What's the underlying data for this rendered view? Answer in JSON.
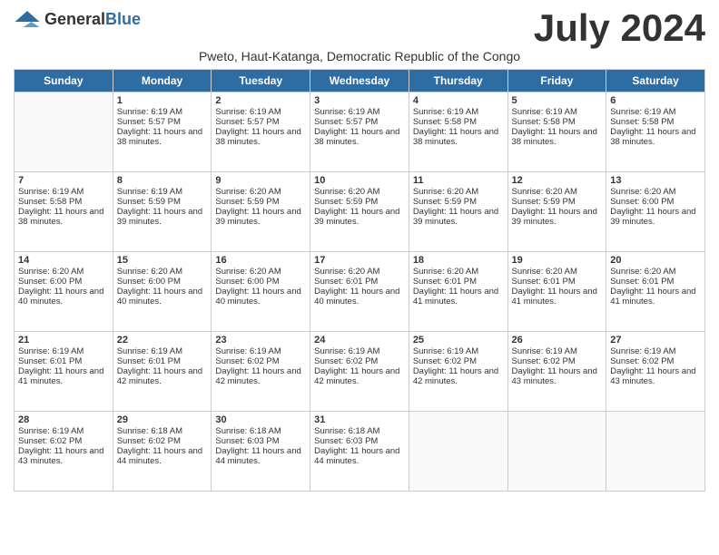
{
  "header": {
    "logo_general": "General",
    "logo_blue": "Blue",
    "month_title": "July 2024",
    "subtitle": "Pweto, Haut-Katanga, Democratic Republic of the Congo"
  },
  "days_of_week": [
    "Sunday",
    "Monday",
    "Tuesday",
    "Wednesday",
    "Thursday",
    "Friday",
    "Saturday"
  ],
  "weeks": [
    [
      {
        "day": "",
        "sunrise": "",
        "sunset": "",
        "daylight": ""
      },
      {
        "day": "1",
        "sunrise": "Sunrise: 6:19 AM",
        "sunset": "Sunset: 5:57 PM",
        "daylight": "Daylight: 11 hours and 38 minutes."
      },
      {
        "day": "2",
        "sunrise": "Sunrise: 6:19 AM",
        "sunset": "Sunset: 5:57 PM",
        "daylight": "Daylight: 11 hours and 38 minutes."
      },
      {
        "day": "3",
        "sunrise": "Sunrise: 6:19 AM",
        "sunset": "Sunset: 5:57 PM",
        "daylight": "Daylight: 11 hours and 38 minutes."
      },
      {
        "day": "4",
        "sunrise": "Sunrise: 6:19 AM",
        "sunset": "Sunset: 5:58 PM",
        "daylight": "Daylight: 11 hours and 38 minutes."
      },
      {
        "day": "5",
        "sunrise": "Sunrise: 6:19 AM",
        "sunset": "Sunset: 5:58 PM",
        "daylight": "Daylight: 11 hours and 38 minutes."
      },
      {
        "day": "6",
        "sunrise": "Sunrise: 6:19 AM",
        "sunset": "Sunset: 5:58 PM",
        "daylight": "Daylight: 11 hours and 38 minutes."
      }
    ],
    [
      {
        "day": "7",
        "sunrise": "Sunrise: 6:19 AM",
        "sunset": "Sunset: 5:58 PM",
        "daylight": "Daylight: 11 hours and 38 minutes."
      },
      {
        "day": "8",
        "sunrise": "Sunrise: 6:19 AM",
        "sunset": "Sunset: 5:59 PM",
        "daylight": "Daylight: 11 hours and 39 minutes."
      },
      {
        "day": "9",
        "sunrise": "Sunrise: 6:20 AM",
        "sunset": "Sunset: 5:59 PM",
        "daylight": "Daylight: 11 hours and 39 minutes."
      },
      {
        "day": "10",
        "sunrise": "Sunrise: 6:20 AM",
        "sunset": "Sunset: 5:59 PM",
        "daylight": "Daylight: 11 hours and 39 minutes."
      },
      {
        "day": "11",
        "sunrise": "Sunrise: 6:20 AM",
        "sunset": "Sunset: 5:59 PM",
        "daylight": "Daylight: 11 hours and 39 minutes."
      },
      {
        "day": "12",
        "sunrise": "Sunrise: 6:20 AM",
        "sunset": "Sunset: 5:59 PM",
        "daylight": "Daylight: 11 hours and 39 minutes."
      },
      {
        "day": "13",
        "sunrise": "Sunrise: 6:20 AM",
        "sunset": "Sunset: 6:00 PM",
        "daylight": "Daylight: 11 hours and 39 minutes."
      }
    ],
    [
      {
        "day": "14",
        "sunrise": "Sunrise: 6:20 AM",
        "sunset": "Sunset: 6:00 PM",
        "daylight": "Daylight: 11 hours and 40 minutes."
      },
      {
        "day": "15",
        "sunrise": "Sunrise: 6:20 AM",
        "sunset": "Sunset: 6:00 PM",
        "daylight": "Daylight: 11 hours and 40 minutes."
      },
      {
        "day": "16",
        "sunrise": "Sunrise: 6:20 AM",
        "sunset": "Sunset: 6:00 PM",
        "daylight": "Daylight: 11 hours and 40 minutes."
      },
      {
        "day": "17",
        "sunrise": "Sunrise: 6:20 AM",
        "sunset": "Sunset: 6:01 PM",
        "daylight": "Daylight: 11 hours and 40 minutes."
      },
      {
        "day": "18",
        "sunrise": "Sunrise: 6:20 AM",
        "sunset": "Sunset: 6:01 PM",
        "daylight": "Daylight: 11 hours and 41 minutes."
      },
      {
        "day": "19",
        "sunrise": "Sunrise: 6:20 AM",
        "sunset": "Sunset: 6:01 PM",
        "daylight": "Daylight: 11 hours and 41 minutes."
      },
      {
        "day": "20",
        "sunrise": "Sunrise: 6:20 AM",
        "sunset": "Sunset: 6:01 PM",
        "daylight": "Daylight: 11 hours and 41 minutes."
      }
    ],
    [
      {
        "day": "21",
        "sunrise": "Sunrise: 6:19 AM",
        "sunset": "Sunset: 6:01 PM",
        "daylight": "Daylight: 11 hours and 41 minutes."
      },
      {
        "day": "22",
        "sunrise": "Sunrise: 6:19 AM",
        "sunset": "Sunset: 6:01 PM",
        "daylight": "Daylight: 11 hours and 42 minutes."
      },
      {
        "day": "23",
        "sunrise": "Sunrise: 6:19 AM",
        "sunset": "Sunset: 6:02 PM",
        "daylight": "Daylight: 11 hours and 42 minutes."
      },
      {
        "day": "24",
        "sunrise": "Sunrise: 6:19 AM",
        "sunset": "Sunset: 6:02 PM",
        "daylight": "Daylight: 11 hours and 42 minutes."
      },
      {
        "day": "25",
        "sunrise": "Sunrise: 6:19 AM",
        "sunset": "Sunset: 6:02 PM",
        "daylight": "Daylight: 11 hours and 42 minutes."
      },
      {
        "day": "26",
        "sunrise": "Sunrise: 6:19 AM",
        "sunset": "Sunset: 6:02 PM",
        "daylight": "Daylight: 11 hours and 43 minutes."
      },
      {
        "day": "27",
        "sunrise": "Sunrise: 6:19 AM",
        "sunset": "Sunset: 6:02 PM",
        "daylight": "Daylight: 11 hours and 43 minutes."
      }
    ],
    [
      {
        "day": "28",
        "sunrise": "Sunrise: 6:19 AM",
        "sunset": "Sunset: 6:02 PM",
        "daylight": "Daylight: 11 hours and 43 minutes."
      },
      {
        "day": "29",
        "sunrise": "Sunrise: 6:18 AM",
        "sunset": "Sunset: 6:02 PM",
        "daylight": "Daylight: 11 hours and 44 minutes."
      },
      {
        "day": "30",
        "sunrise": "Sunrise: 6:18 AM",
        "sunset": "Sunset: 6:03 PM",
        "daylight": "Daylight: 11 hours and 44 minutes."
      },
      {
        "day": "31",
        "sunrise": "Sunrise: 6:18 AM",
        "sunset": "Sunset: 6:03 PM",
        "daylight": "Daylight: 11 hours and 44 minutes."
      },
      {
        "day": "",
        "sunrise": "",
        "sunset": "",
        "daylight": ""
      },
      {
        "day": "",
        "sunrise": "",
        "sunset": "",
        "daylight": ""
      },
      {
        "day": "",
        "sunrise": "",
        "sunset": "",
        "daylight": ""
      }
    ]
  ]
}
